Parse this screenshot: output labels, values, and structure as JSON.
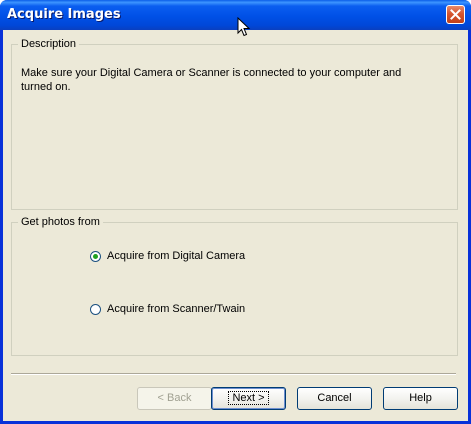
{
  "window": {
    "title": "Acquire Images"
  },
  "description": {
    "legend": "Description",
    "text": "Make sure your Digital Camera or Scanner is connected to your computer and turned on."
  },
  "photos": {
    "legend": "Get photos from",
    "options": [
      {
        "label": "Acquire from Digital Camera",
        "checked": true
      },
      {
        "label": "Acquire from Scanner/Twain",
        "checked": false
      }
    ]
  },
  "buttons": {
    "back": "< Back",
    "next": "Next >",
    "cancel": "Cancel",
    "help": "Help"
  },
  "icons": {
    "close": "close-icon",
    "cursor": "mouse-cursor-icon"
  }
}
